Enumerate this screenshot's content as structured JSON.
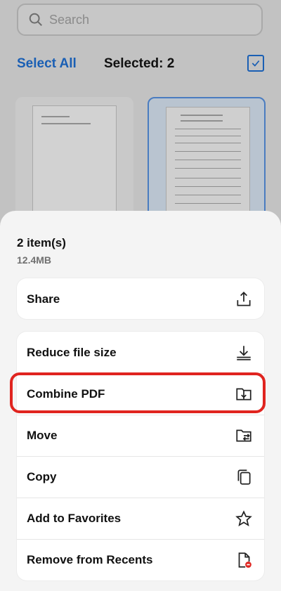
{
  "search": {
    "placeholder": "Search"
  },
  "header": {
    "select_all": "Select All",
    "selected_label": "Selected: 2"
  },
  "sheet": {
    "title": "2 item(s)",
    "size": "12.4MB",
    "actions_primary": [
      {
        "label": "Share",
        "icon": "share-icon"
      }
    ],
    "actions": [
      {
        "label": "Reduce file size",
        "icon": "download-icon"
      },
      {
        "label": "Combine PDF",
        "icon": "combine-pdf-icon"
      },
      {
        "label": "Move",
        "icon": "move-folder-icon"
      },
      {
        "label": "Copy",
        "icon": "copy-icon"
      },
      {
        "label": "Add to Favorites",
        "icon": "star-icon"
      },
      {
        "label": "Remove from Recents",
        "icon": "remove-file-icon"
      }
    ]
  },
  "colors": {
    "accent": "#1a5fb4",
    "highlight": "#e0241f"
  }
}
